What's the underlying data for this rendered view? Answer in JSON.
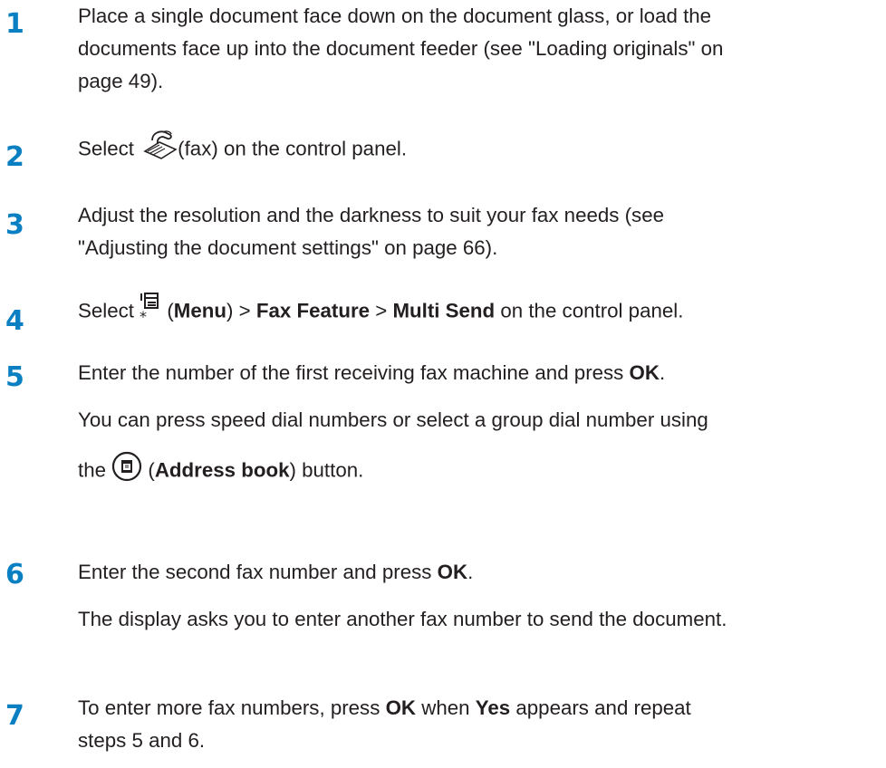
{
  "colors": {
    "step_number": "#0a7fc2",
    "text": "#231f20"
  },
  "steps": [
    {
      "number": "1",
      "line1": "Place a single document face down on the document glass, or load the",
      "line2": "documents face up into the document feeder (see \"Loading originals\" on",
      "line3": "page 49)."
    },
    {
      "number": "2",
      "before_icon": "Select ",
      "icon": "fax-icon",
      "after_icon": "(fax) on the control panel."
    },
    {
      "number": "3",
      "line1": "Adjust the resolution and the darkness to suit your fax needs (see",
      "line2": "\"Adjusting the document settings\" on page 66)."
    },
    {
      "number": "4",
      "before_icon": "Select ",
      "icon": "menu-icon",
      "paren_open": " (",
      "menu": "Menu",
      "sep1": ") > ",
      "fax_feature": "Fax Feature",
      "sep2": " > ",
      "multi_send": "Multi Send",
      "end": " on the control panel."
    },
    {
      "number": "5",
      "line1": "Enter the number of the first receiving fax machine and press ",
      "ok": "OK",
      "period": ".",
      "sub1": "You can press speed dial numbers or select a group dial number using",
      "sub2_before": "the ",
      "sub2_icon": "address-book-icon",
      "sub2_paren_open": " (",
      "address_book": "Address book",
      "sub2_end": ") button."
    },
    {
      "number": "6",
      "line1": "Enter the second fax number and press ",
      "ok": "OK",
      "period": ".",
      "sub1": "The display asks you to enter another fax number to send the document."
    },
    {
      "number": "7",
      "line1_a": "To enter more fax numbers, press ",
      "ok": "OK",
      "line1_b": " when ",
      "yes": "Yes",
      "line1_c": " appears and repeat",
      "line2": "steps 5 and 6."
    }
  ]
}
